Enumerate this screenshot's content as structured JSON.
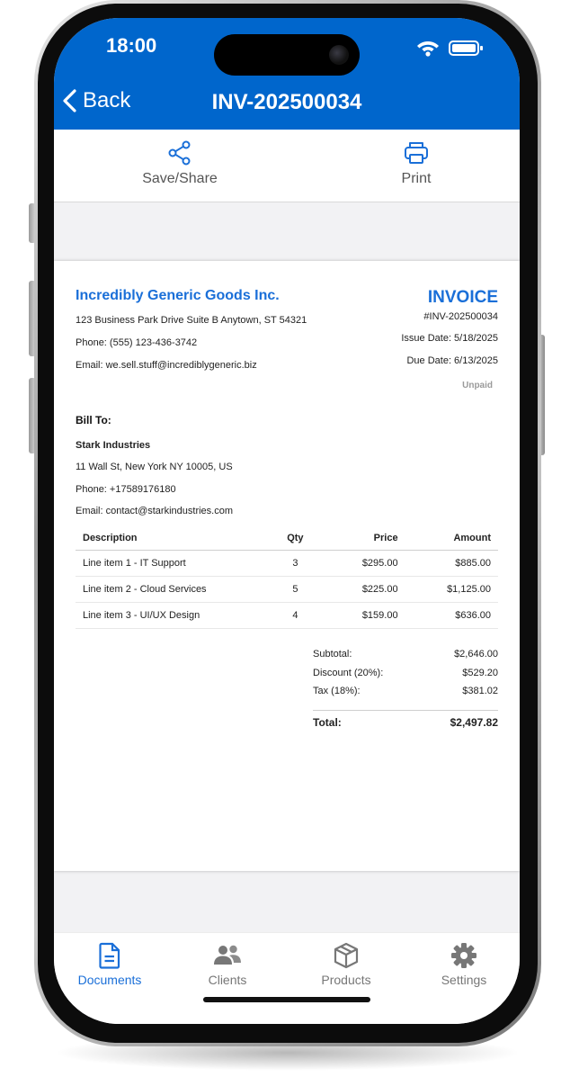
{
  "status_bar": {
    "time": "18:00"
  },
  "nav": {
    "back_label": "Back",
    "title": "INV-202500034"
  },
  "toolbar": {
    "share_label": "Save/Share",
    "print_label": "Print"
  },
  "seller": {
    "name": "Incredibly Generic Goods Inc.",
    "address": "123 Business Park Drive Suite B Anytown, ST 54321",
    "phone": "Phone: (555) 123-436-3742",
    "email": "Email: we.sell.stuff@incrediblygeneric.biz"
  },
  "invoice": {
    "heading": "INVOICE",
    "number": "#INV-202500034",
    "issue_date": "Issue Date: 5/18/2025",
    "due_date": "Due Date: 6/13/2025",
    "status": "Unpaid"
  },
  "bill_to": {
    "heading": "Bill To:",
    "name": "Stark Industries",
    "address": "11 Wall St, New York NY 10005, US",
    "phone": "Phone: +17589176180",
    "email": "Email: contact@starkindustries.com"
  },
  "items_header": {
    "description": "Description",
    "qty": "Qty",
    "price": "Price",
    "amount": "Amount"
  },
  "items": [
    {
      "description": "Line item 1 - IT Support",
      "qty": "3",
      "price": "$295.00",
      "amount": "$885.00"
    },
    {
      "description": "Line item 2 - Cloud Services",
      "qty": "5",
      "price": "$225.00",
      "amount": "$1,125.00"
    },
    {
      "description": "Line item 3 - UI/UX Design",
      "qty": "4",
      "price": "$159.00",
      "amount": "$636.00"
    }
  ],
  "totals": {
    "subtotal_label": "Subtotal:",
    "subtotal": "$2,646.00",
    "discount_label": "Discount (20%):",
    "discount": "$529.20",
    "tax_label": "Tax (18%):",
    "tax": "$381.02",
    "total_label": "Total:",
    "total": "$2,497.82"
  },
  "tabs": [
    {
      "label": "Documents",
      "icon": "document-icon",
      "active": true
    },
    {
      "label": "Clients",
      "icon": "people-icon",
      "active": false
    },
    {
      "label": "Products",
      "icon": "box-icon",
      "active": false
    },
    {
      "label": "Settings",
      "icon": "gear-icon",
      "active": false
    }
  ],
  "colors": {
    "brand": "#0066cc",
    "accent": "#1a6fd8",
    "muted": "#9a9a9a"
  }
}
